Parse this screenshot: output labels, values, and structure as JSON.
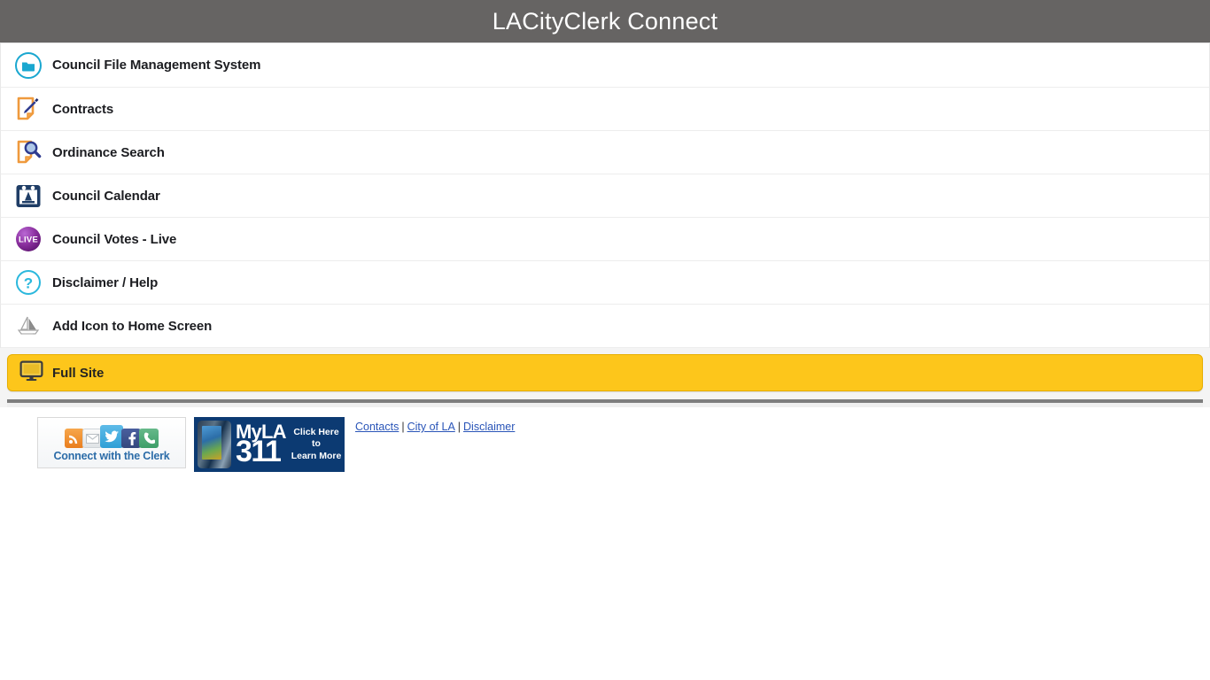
{
  "header": {
    "title": "LACityClerk Connect",
    "bg_color": "#666463",
    "text_color": "#ffffff"
  },
  "menu": {
    "items": [
      {
        "label": "Council File Management System",
        "icon": "folder-circle-icon",
        "icon_color": "#1aa7d0"
      },
      {
        "label": "Contracts",
        "icon": "document-pen-icon",
        "icon_color": "#ef9a3d"
      },
      {
        "label": "Ordinance Search",
        "icon": "document-search-icon",
        "icon_color": "#ef9a3d"
      },
      {
        "label": "Council Calendar",
        "icon": "calendar-icon",
        "icon_color": "#1f3d66"
      },
      {
        "label": "Council Votes - Live",
        "icon": "live-badge-icon",
        "icon_color": "#7b2c8f"
      },
      {
        "label": "Disclaimer / Help",
        "icon": "question-circle-icon",
        "icon_color": "#2bb8dd"
      },
      {
        "label": "Add Icon to Home Screen",
        "icon": "add-to-home-icon",
        "icon_color": "#9a9a9a"
      }
    ]
  },
  "full_site": {
    "label": "Full Site",
    "icon": "monitor-icon",
    "bg_color": "#fdc61b",
    "text_color": "#232323"
  },
  "footer": {
    "clerk_badge": {
      "caption": "Connect with the Clerk",
      "icons": [
        {
          "name": "rss-icon",
          "glyph": "◖",
          "color": "#e97e1e"
        },
        {
          "name": "email-icon",
          "glyph": "✉",
          "color": "#dfe3e6"
        },
        {
          "name": "twitter-icon",
          "glyph": "ᵗ",
          "color": "#2f9fd6"
        },
        {
          "name": "facebook-icon",
          "glyph": "f",
          "color": "#34477e"
        },
        {
          "name": "phone-icon",
          "glyph": "✆",
          "color": "#3d9e68"
        }
      ]
    },
    "myla311_badge": {
      "brand": "MyLA",
      "number": "311",
      "cta_line1": "Click Here",
      "cta_line2": "to",
      "cta_line3": "Learn More",
      "bg_color": "#0c3a72"
    },
    "links": [
      {
        "label": "Contacts"
      },
      {
        "label": "City of LA"
      },
      {
        "label": "Disclaimer"
      }
    ],
    "link_separator": "|"
  }
}
